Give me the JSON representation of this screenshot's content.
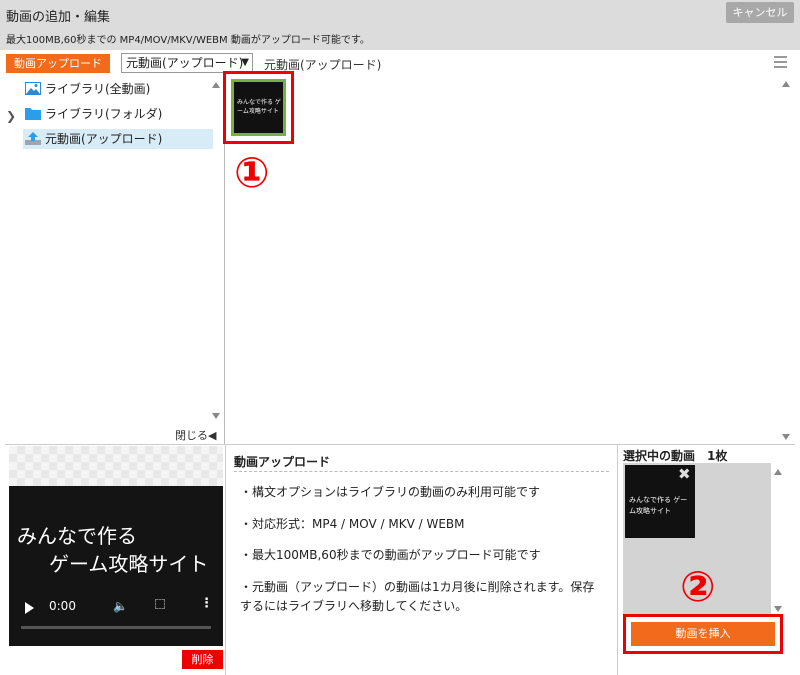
{
  "header": {
    "title": "動画の追加・編集",
    "subtitle": "最大100MB,60秒までの MP4/MOV/MKV/WEBM 動画がアップロード可能です。",
    "cancel_label": "キャンセル"
  },
  "toolbar": {
    "upload_label": "動画アップロード",
    "select_value": "元動画(アップロード)",
    "current_folder": "元動画(アップロード)"
  },
  "tree": {
    "items": [
      {
        "label": "ライブラリ(全動画)",
        "icon": "image-icon"
      },
      {
        "label": "ライブラリ(フォルダ)",
        "icon": "folder-icon"
      },
      {
        "label": "元動画(アップロード)",
        "icon": "upload-icon"
      }
    ],
    "close_label": "閉じる◀"
  },
  "grid": {
    "thumb_text": "みんなで作る ゲーム攻略サイト",
    "mark1": "①"
  },
  "preview": {
    "line1": "みんなで作る",
    "line2": "ゲーム攻略サイト",
    "time": "0:00",
    "delete_label": "削除"
  },
  "info": {
    "title": "動画アップロード",
    "items": [
      "・構文オプションはライブラリの動画のみ利用可能です",
      "・対応形式：MP4 / MOV / MKV / WEBM",
      "・最大100MB,60秒までの動画がアップロード可能です",
      "・元動画（アップロード）の動画は1カ月後に削除されます。保存するにはライブラリへ移動してください。"
    ]
  },
  "selected": {
    "title": "選択中の動画　1枚",
    "thumb_text": "みんなで作る ゲーム攻略サイト",
    "mark2": "②",
    "insert_label": "動画を挿入"
  },
  "colors": {
    "accent": "#f26a1b",
    "highlight": "#e00000",
    "header_bg": "#dcdcdc"
  }
}
